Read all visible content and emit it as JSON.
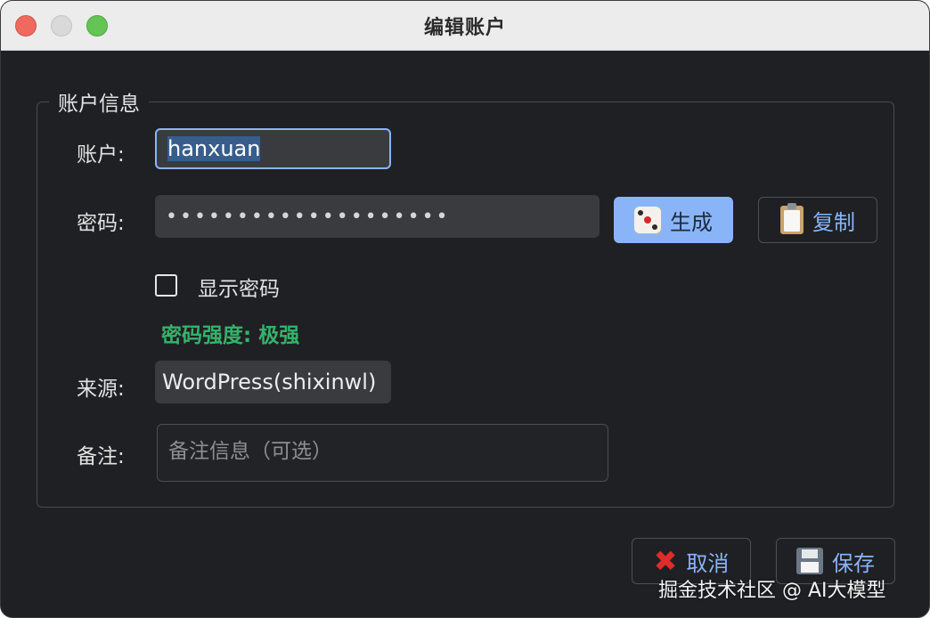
{
  "window": {
    "title": "编辑账户"
  },
  "group": {
    "title": "账户信息"
  },
  "account": {
    "label": "账户:",
    "value": "hanxuan"
  },
  "password": {
    "label": "密码:",
    "masked_value": "••••••••••••••••••••",
    "generate_label": "生成",
    "generate_icon": "dice-icon",
    "copy_label": "复制",
    "copy_icon": "clipboard-icon"
  },
  "show_password": {
    "label": "显示密码",
    "checked": false
  },
  "strength": {
    "text": "密码强度: 极强",
    "color": "#35b26b"
  },
  "source": {
    "label": "来源:",
    "value": "WordPress(shixinwl)"
  },
  "notes": {
    "label": "备注:",
    "placeholder": "备注信息（可选）",
    "value": ""
  },
  "actions": {
    "cancel_label": "取消",
    "cancel_icon": "x-icon",
    "save_label": "保存",
    "save_icon": "floppy-disk-icon"
  },
  "watermark": "掘金技术社区 @ AI大模型",
  "colors": {
    "accent": "#8ab4f8",
    "background": "#1f2023",
    "input_bg": "#3a3b3f",
    "danger": "#e02b2b"
  }
}
